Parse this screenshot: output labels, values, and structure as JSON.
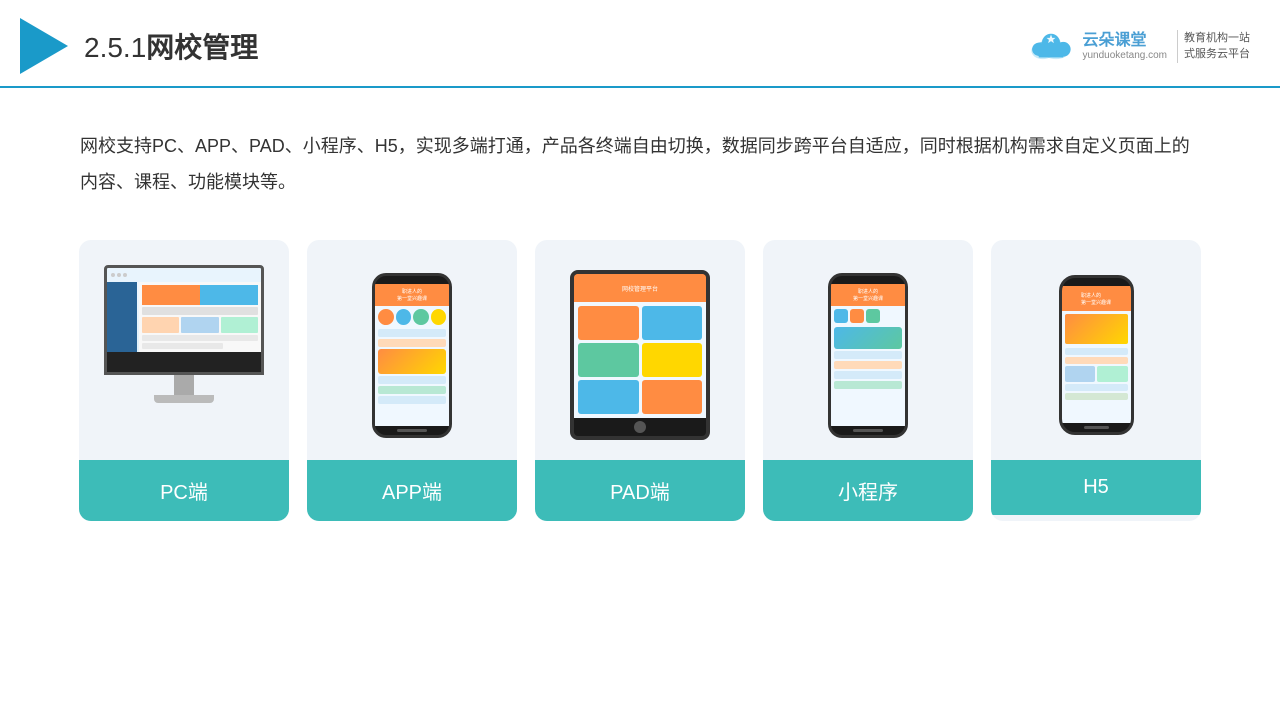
{
  "header": {
    "section_num": "2.5.1",
    "title": "网校管理",
    "brand_name": "云朵课堂",
    "brand_url": "yunduoketang.com",
    "brand_tagline": "教育机构一站\n式服务云平台"
  },
  "description": {
    "text": "网校支持PC、APP、PAD、小程序、H5，实现多端打通，产品各终端自由切换，数据同步跨平台自适应，同时根据机构需求自定义页面上的内容、课程、功能模块等。"
  },
  "cards": [
    {
      "label": "PC端"
    },
    {
      "label": "APP端"
    },
    {
      "label": "PAD端"
    },
    {
      "label": "小程序"
    },
    {
      "label": "H5"
    }
  ],
  "colors": {
    "primary": "#1a9ac9",
    "card_bg": "#f0f4f9",
    "card_label_bg": "#3dbcb8",
    "header_border": "#1a9ac9"
  }
}
